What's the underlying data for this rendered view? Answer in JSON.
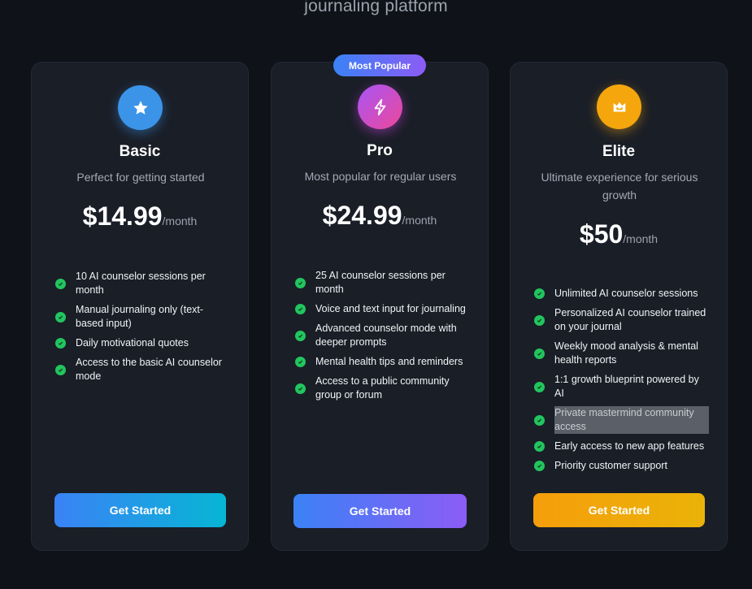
{
  "header": {
    "subtitle": "journaling platform"
  },
  "colors": {
    "background": "#0f1218",
    "card": "#1a1e27",
    "check": "#22c55e"
  },
  "plans": [
    {
      "name": "Basic",
      "icon": "star-icon",
      "description": "Perfect for getting started",
      "price": "$14.99",
      "period": "/month",
      "features": [
        "10 AI counselor sessions per month",
        "Manual journaling only (text-based input)",
        "Daily motivational quotes",
        "Access to the basic AI counselor mode"
      ],
      "cta": "Get Started"
    },
    {
      "name": "Pro",
      "icon": "lightning-icon",
      "badge": "Most Popular",
      "description": "Most popular for regular users",
      "price": "$24.99",
      "period": "/month",
      "features": [
        "25 AI counselor sessions per month",
        "Voice and text input for journaling",
        "Advanced counselor mode with deeper prompts",
        "Mental health tips and reminders",
        "Access to a public community group or forum"
      ],
      "cta": "Get Started"
    },
    {
      "name": "Elite",
      "icon": "crown-icon",
      "description": "Ultimate experience for serious growth",
      "price": "$50",
      "period": "/month",
      "features": [
        "Unlimited AI counselor sessions",
        "Personalized AI counselor trained on your journal",
        "Weekly mood analysis & mental health reports",
        "1:1 growth blueprint powered by AI",
        "Private mastermind community access",
        "Early access to new app features",
        "Priority customer support"
      ],
      "cta": "Get Started"
    }
  ]
}
